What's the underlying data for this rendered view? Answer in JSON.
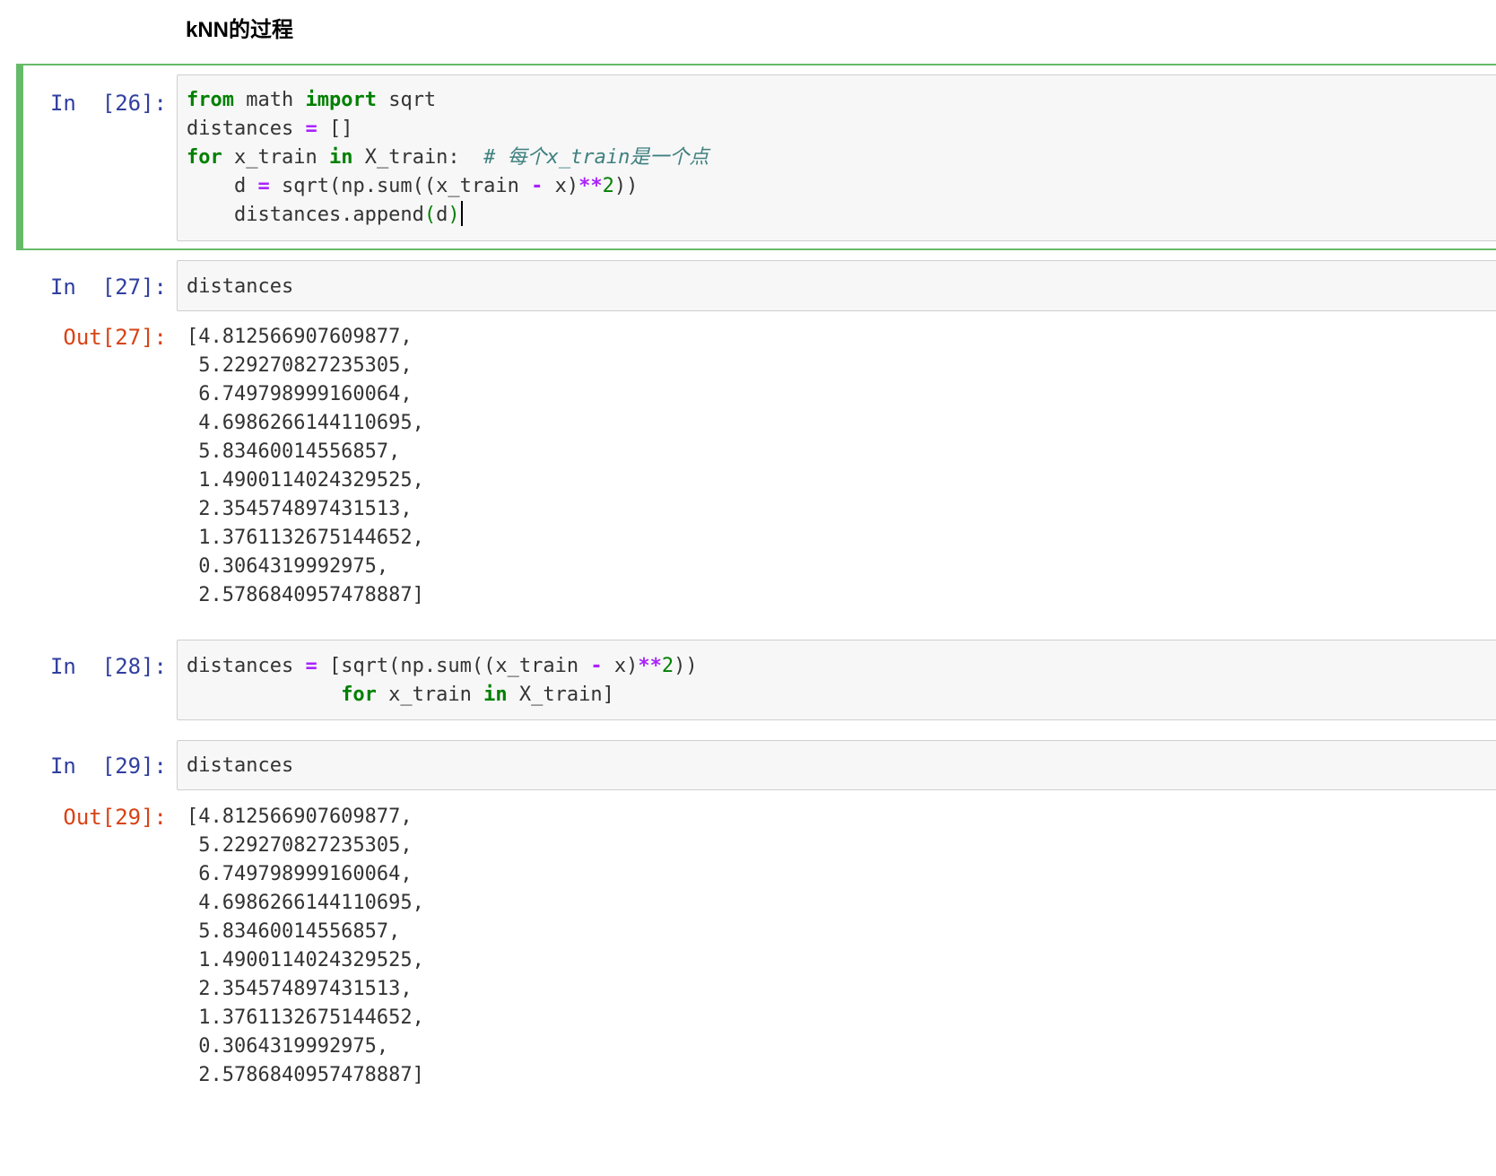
{
  "notebook": {
    "heading": "kNN的过程",
    "cells": [
      {
        "in_prompt": "In  [26]:",
        "code_lines": [
          [
            {
              "t": "from",
              "c": "kw"
            },
            {
              "t": " math ",
              "c": ""
            },
            {
              "t": "import",
              "c": "kw"
            },
            {
              "t": " sqrt",
              "c": ""
            }
          ],
          [
            {
              "t": "distances ",
              "c": ""
            },
            {
              "t": "=",
              "c": "op"
            },
            {
              "t": " []",
              "c": ""
            }
          ],
          [
            {
              "t": "for",
              "c": "kw"
            },
            {
              "t": " x_train ",
              "c": ""
            },
            {
              "t": "in",
              "c": "kw"
            },
            {
              "t": " X_train:  ",
              "c": ""
            },
            {
              "t": "# 每个x_train是一个点",
              "c": "cm"
            }
          ],
          [
            {
              "t": "    d ",
              "c": ""
            },
            {
              "t": "=",
              "c": "op"
            },
            {
              "t": " sqrt(np.sum((x_train ",
              "c": ""
            },
            {
              "t": "-",
              "c": "op"
            },
            {
              "t": " x)",
              "c": ""
            },
            {
              "t": "**",
              "c": "op"
            },
            {
              "t": "2",
              "c": "num"
            },
            {
              "t": "))",
              "c": ""
            }
          ],
          [
            {
              "t": "    distances.append",
              "c": ""
            },
            {
              "t": "(",
              "c": "paren-hl"
            },
            {
              "t": "d",
              "c": ""
            },
            {
              "t": ")",
              "c": "paren-hl"
            }
          ]
        ]
      },
      {
        "in_prompt": "In  [27]:",
        "code_lines": [
          [
            {
              "t": "distances",
              "c": ""
            }
          ]
        ],
        "out_prompt": "Out[27]:",
        "output": "[4.812566907609877,\n 5.229270827235305,\n 6.749798999160064,\n 4.6986266144110695,\n 5.83460014556857,\n 1.4900114024329525,\n 2.354574897431513,\n 1.3761132675144652,\n 0.3064319992975,\n 2.5786840957478887]"
      },
      {
        "in_prompt": "In  [28]:",
        "code_lines": [
          [
            {
              "t": "distances ",
              "c": ""
            },
            {
              "t": "=",
              "c": "op"
            },
            {
              "t": " [sqrt(np.sum((x_train ",
              "c": ""
            },
            {
              "t": "-",
              "c": "op"
            },
            {
              "t": " x)",
              "c": ""
            },
            {
              "t": "**",
              "c": "op"
            },
            {
              "t": "2",
              "c": "num"
            },
            {
              "t": "))",
              "c": ""
            }
          ],
          [
            {
              "t": "             ",
              "c": ""
            },
            {
              "t": "for",
              "c": "kw"
            },
            {
              "t": " x_train ",
              "c": ""
            },
            {
              "t": "in",
              "c": "kw"
            },
            {
              "t": " X_train]",
              "c": ""
            }
          ]
        ]
      },
      {
        "in_prompt": "In  [29]:",
        "code_lines": [
          [
            {
              "t": "distances",
              "c": ""
            }
          ]
        ],
        "out_prompt": "Out[29]:",
        "output": "[4.812566907609877,\n 5.229270827235305,\n 6.749798999160064,\n 4.6986266144110695,\n 5.83460014556857,\n 1.4900114024329525,\n 2.354574897431513,\n 1.3761132675144652,\n 0.3064319992975,\n 2.5786840957478887]"
      }
    ]
  }
}
